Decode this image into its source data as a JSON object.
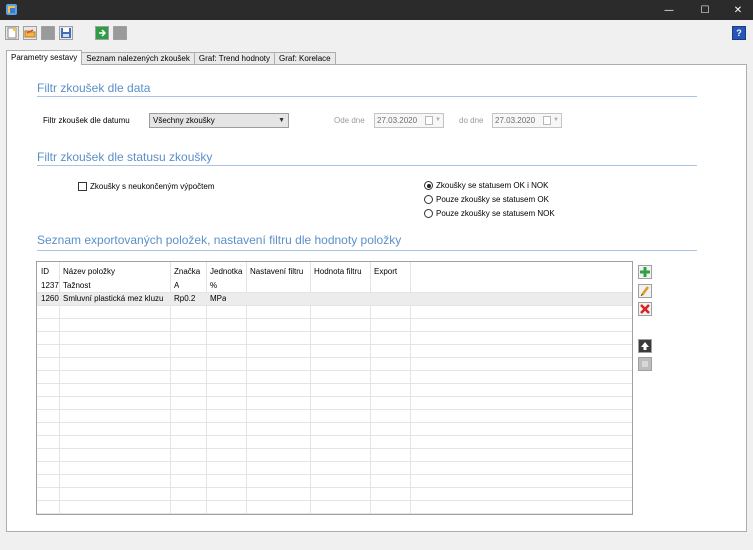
{
  "window": {
    "minimize": "—",
    "maximize": "☐",
    "close": "✕"
  },
  "help": {
    "label": "?"
  },
  "tabs": [
    {
      "label": "Parametry sestavy"
    },
    {
      "label": "Seznam nalezených zkoušek"
    },
    {
      "label": "Graf: Trend hodnoty"
    },
    {
      "label": "Graf: Korelace"
    }
  ],
  "date_filter": {
    "title": "Filtr zkoušek dle data",
    "label": "Filtr zkoušek dle datumu",
    "selected": "Všechny zkoušky",
    "from_label": "Ode dne",
    "from_value": "27.03.2020",
    "to_label": "do dne",
    "to_value": "27.03.2020"
  },
  "status_filter": {
    "title": "Filtr zkoušek dle statusu zkoušky",
    "unfinished_label": "Zkoušky s neukončeným výpočtem",
    "options": [
      {
        "label": "Zkoušky se statusem OK i NOK"
      },
      {
        "label": "Pouze zkoušky se statusem OK"
      },
      {
        "label": "Pouze zkoušky se statusem NOK"
      }
    ]
  },
  "export_list": {
    "title": "Seznam exportovaných položek, nastavení filtru dle hodnoty položky",
    "columns": [
      "ID",
      "Název položky",
      "Značka",
      "Jednotka",
      "Nastavení filtru",
      "Hodnota filtru",
      "Export"
    ],
    "rows": [
      {
        "id": "1237",
        "name": "Tažnost",
        "symbol": "A",
        "unit": "%"
      },
      {
        "id": "1260",
        "name": "Smluvní plastická mez kluzu",
        "symbol": "Rp0.2",
        "unit": "MPa"
      }
    ]
  }
}
